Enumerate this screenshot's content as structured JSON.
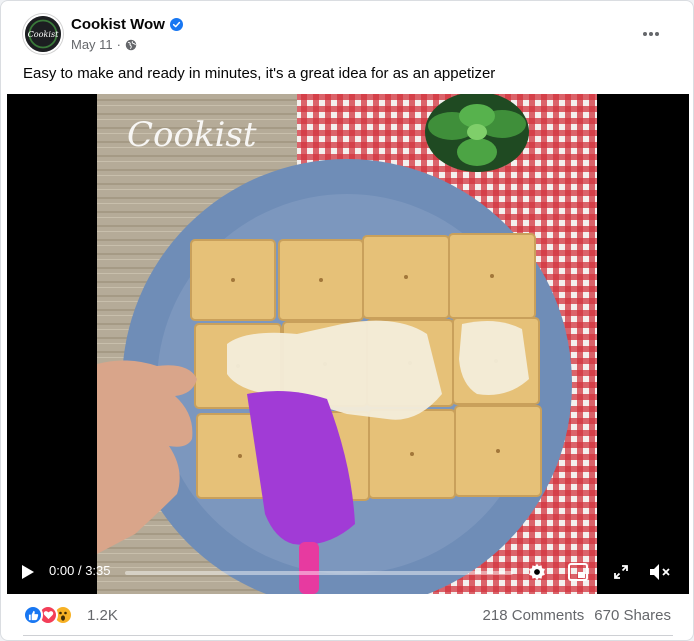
{
  "post": {
    "page_name": "Cookist Wow",
    "date": "May 11",
    "separator": "·",
    "caption": "Easy to make and ready in minutes, it's a great idea for as an appetizer",
    "avatar_text": "Cookist"
  },
  "video": {
    "watermark": "Cookist",
    "current_time": "0:00",
    "duration": "3:35",
    "progress": 0,
    "controls": [
      "play-icon",
      "settings-icon",
      "miniplayer-icon",
      "fullscreen-icon",
      "volume-muted-icon"
    ]
  },
  "engagement": {
    "reactions": [
      "like-icon",
      "love-icon",
      "wow-icon"
    ],
    "reaction_count": "1.2K",
    "comments": "218 Comments",
    "shares": "670 Shares"
  },
  "colors": {
    "like": "#1877f2",
    "love": "#f33e58",
    "wow": "#f7b125",
    "verified": "#1877f2",
    "meta_text": "#65676b"
  }
}
